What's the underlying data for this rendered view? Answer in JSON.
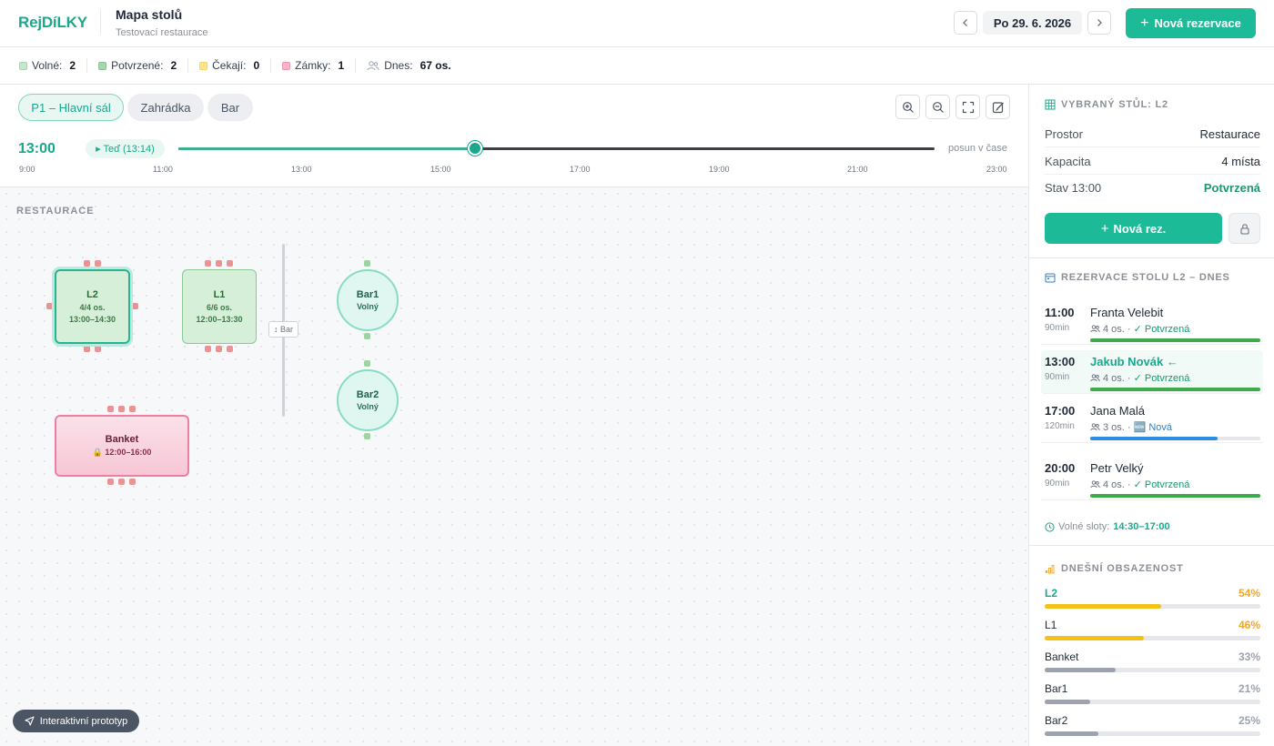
{
  "app": {
    "brand": "RejDíLKY",
    "title": "Mapa stolů",
    "subtitle": "Testovací restaurace"
  },
  "header": {
    "date": "Po 29. 6. 2026",
    "new_reservation": "Nová rezervace"
  },
  "stats": [
    {
      "label": "Volné:",
      "value": "2",
      "color": "#c8e6cc",
      "icon": "square-swatch"
    },
    {
      "label": "Potvrzené:",
      "value": "2",
      "color": "#a8d5ae",
      "icon": "square-swatch"
    },
    {
      "label": "Čekají:",
      "value": "0",
      "color": "#fde68a",
      "icon": "square-swatch"
    },
    {
      "label": "Zámky:",
      "value": "1",
      "color": "#f4b6c8",
      "icon": "square-swatch"
    },
    {
      "label": "Dnes:",
      "value": "67 os.",
      "icon": "people-icon"
    }
  ],
  "tabs": [
    "P1 – Hlavní sál",
    "Zahrádka",
    "Bar"
  ],
  "timeline": {
    "current_time": "13:00",
    "now_chip": "▸ Teď (13:14)",
    "note": "posun v čase",
    "ticks": [
      "9:00",
      "11:00",
      "13:00",
      "15:00",
      "17:00",
      "19:00",
      "21:00",
      "23:00"
    ],
    "range_hours": [
      9,
      23
    ],
    "value_hours": 14.5
  },
  "canvas": {
    "area_label": "RESTAURACE",
    "wall_label": "↕ Bar",
    "tables": {
      "L2": {
        "name": "L2",
        "line1": "4/4 os.",
        "line2": "13:00–14:30"
      },
      "L1": {
        "name": "L1",
        "line1": "6/6 os.",
        "line2": "12:00–13:30"
      },
      "Bar1": {
        "name": "Bar1",
        "line1": "Volný"
      },
      "Bar2": {
        "name": "Bar2",
        "line1": "Volný"
      },
      "Banket": {
        "name": "Banket",
        "line1": "🔒 12:00–16:00"
      }
    },
    "prototype_chip": "Interaktivní prototyp"
  },
  "panel": {
    "selected_title": "VYBRANÝ STŮL: L2",
    "props": [
      {
        "k": "Prostor",
        "v": "Restaurace"
      },
      {
        "k": "Kapacita",
        "v": "4 místa"
      },
      {
        "k": "Stav 13:00",
        "v": "Potvrzená"
      }
    ],
    "new_rez": "Nová rez.",
    "res_title": "REZERVACE STOLU L2 – DNES",
    "reservations": [
      {
        "time": "11:00",
        "dur": "90min",
        "name": "Franta Velebit",
        "people": "4 os. ·",
        "status": "✓ Potvrzená",
        "progress": 1.0,
        "color": "#3faa4a"
      },
      {
        "time": "13:00",
        "dur": "90min",
        "name": "Jakub Novák ←",
        "people": "4 os. ·",
        "status": "✓ Potvrzená",
        "progress": 1.0,
        "color": "#3faa4a"
      },
      {
        "time": "17:00",
        "dur": "120min",
        "name": "Jana Malá",
        "people": "3 os. ·",
        "status": "🆕 Nová",
        "progress": 0.75,
        "color": "#2b8ee0"
      },
      {
        "time": "20:00",
        "dur": "90min",
        "name": "Petr Velký",
        "people": "4 os. ·",
        "status": "✓ Potvrzená",
        "progress": 1.0,
        "color": "#3faa4a"
      }
    ],
    "free_slots_label": "Volné sloty:",
    "free_slots_value": "14:30–17:00",
    "occ_title": "DNEŠNÍ OBSAZENOST",
    "occupancy": [
      {
        "name": "L2",
        "pct": "54%",
        "value": 0.54,
        "color": "#f5c116",
        "highlight": true
      },
      {
        "name": "L1",
        "pct": "46%",
        "value": 0.46,
        "color": "#f5c116",
        "highlight": false
      },
      {
        "name": "Banket",
        "pct": "33%",
        "value": 0.33,
        "color": "#9ca3af",
        "highlight": false
      },
      {
        "name": "Bar1",
        "pct": "21%",
        "value": 0.21,
        "color": "#9ca3af",
        "highlight": false
      },
      {
        "name": "Bar2",
        "pct": "25%",
        "value": 0.25,
        "color": "#9ca3af",
        "highlight": false
      }
    ]
  },
  "colors": {
    "accent": "#1dba98",
    "confirmed": "#1a9a6a",
    "new": "#2b7fd0",
    "locked": "#f4b6c8"
  }
}
